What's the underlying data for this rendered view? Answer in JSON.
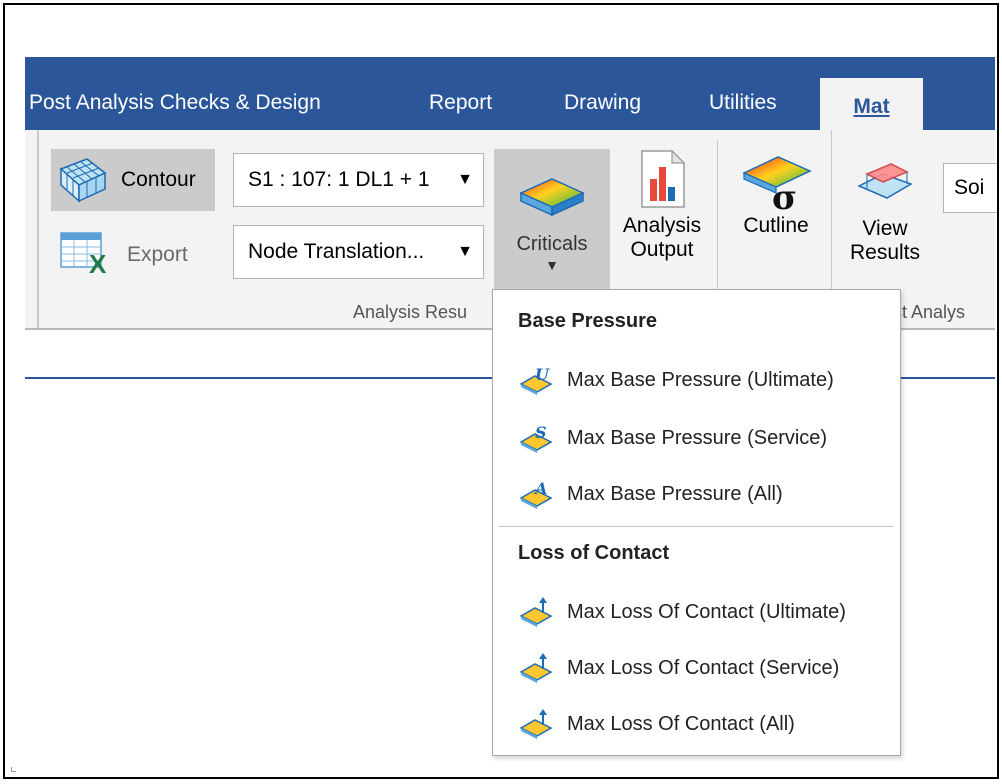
{
  "tabs": [
    {
      "label": "Post Analysis Checks & Design"
    },
    {
      "label": "Report"
    },
    {
      "label": "Drawing"
    },
    {
      "label": "Utilities"
    },
    {
      "label": "Mat",
      "active": true
    }
  ],
  "ribbon": {
    "contour_label": "Contour",
    "export_label": "Export",
    "load_combo_value": "S1 : 107: 1 DL1 + 1",
    "result_type_value": "Node Translation...",
    "criticals_label": "Criticals",
    "analysis_output_label": "Analysis Output",
    "analysis_output_line1": "Analysis",
    "analysis_output_line2": "Output",
    "cutline_label": "Cutline",
    "view_results_line1": "View",
    "view_results_line2": "Results",
    "soil_partial": "Soi",
    "group_analysis_results": "Analysis Resu",
    "group_post_analysis": "st Analys"
  },
  "dropdown": {
    "sections": [
      {
        "header": "Base Pressure",
        "items": [
          {
            "label": "Max Base Pressure (Ultimate)",
            "icon_letter": "U"
          },
          {
            "label": "Max Base Pressure (Service)",
            "icon_letter": "S"
          },
          {
            "label": "Max Base Pressure (All)",
            "icon_letter": "A"
          }
        ]
      },
      {
        "header": "Loss of Contact",
        "items": [
          {
            "label": "Max Loss Of Contact (Ultimate)"
          },
          {
            "label": "Max Loss Of Contact (Service)"
          },
          {
            "label": "Max Loss Of Contact (All)"
          }
        ]
      }
    ]
  },
  "colors": {
    "tab_bar": "#2b579a",
    "ribbon_bg": "#f3f3f3",
    "selected_button": "#cbcbcb",
    "icon_blue": "#1d6ab5"
  }
}
